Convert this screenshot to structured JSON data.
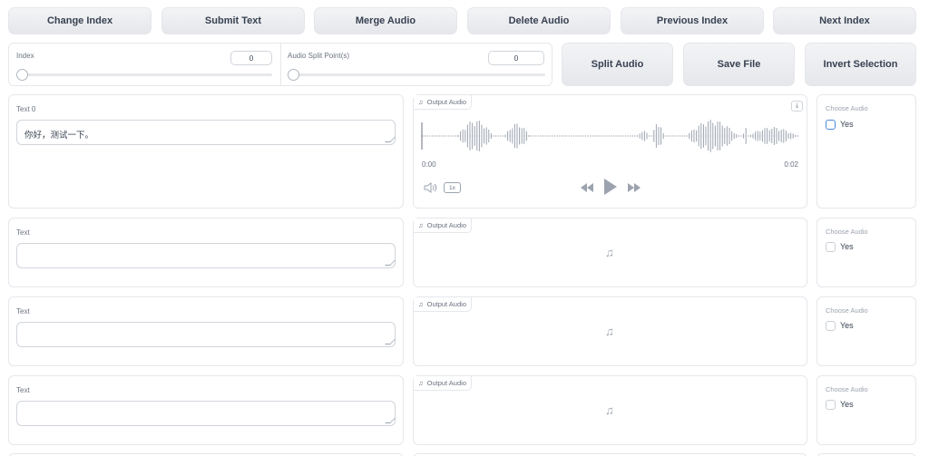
{
  "toolbar": {
    "change_index": "Change Index",
    "submit_text": "Submit Text",
    "merge_audio": "Merge Audio",
    "delete_audio": "Delete Audio",
    "previous_index": "Previous Index",
    "next_index": "Next Index"
  },
  "controls": {
    "index_label": "Index",
    "index_value": "0",
    "split_label": "Audio Split Point(s)",
    "split_value": "0",
    "split_audio": "Split Audio",
    "save_file": "Save File",
    "invert_selection": "Invert Selection"
  },
  "rows": [
    {
      "text_label": "Text 0",
      "text_value": "你好，测试一下。",
      "audio_label": "Output Audio",
      "choose_label": "Choose Audio",
      "choose_option": "Yes",
      "player": {
        "time_current": "0:00",
        "time_total": "0:02",
        "speed": "1x"
      }
    },
    {
      "text_label": "Text",
      "text_value": "",
      "audio_label": "Output Audio",
      "choose_label": "Choose Audio",
      "choose_option": "Yes"
    },
    {
      "text_label": "Text",
      "text_value": "",
      "audio_label": "Output Audio",
      "choose_label": "Choose Audio",
      "choose_option": "Yes"
    },
    {
      "text_label": "Text",
      "text_value": "",
      "audio_label": "Output Audio",
      "choose_label": "Choose Audio",
      "choose_option": "Yes"
    }
  ],
  "icons": {
    "music": "music-note-icon",
    "download": "download-icon",
    "volume": "volume-icon",
    "rewind": "rewind-icon",
    "play": "play-icon",
    "forward": "fast-forward-icon"
  },
  "colors": {
    "accent": "#4b89dc",
    "waveform": "#9ca3af",
    "button_bg": "#e5e7eb"
  }
}
